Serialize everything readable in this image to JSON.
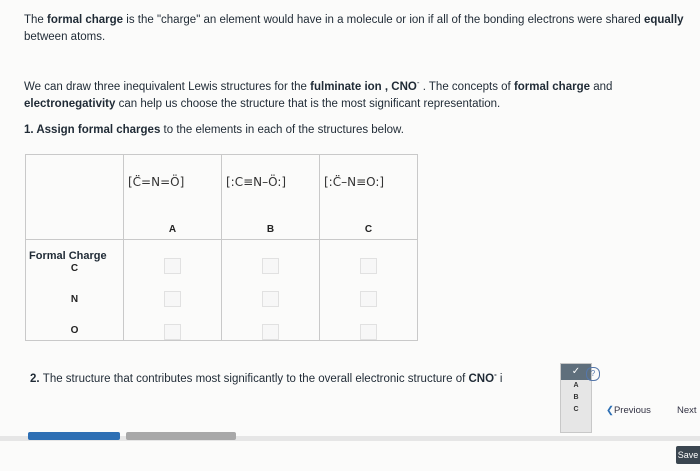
{
  "intro": {
    "p1_a": "The ",
    "p1_b": "formal charge",
    "p1_c": " is the \"charge\" an element would have in a molecule or ion if all of the bonding electrons were shared ",
    "p1_d": "equally",
    "p1_e": " between atoms."
  },
  "para2": {
    "a": "We can draw three inequivalent Lewis structures for the ",
    "b": "fulminate ion",
    "c": " , CNO",
    "c_sup": "-",
    "d": " . The concepts of ",
    "e": "formal charge",
    "f": " and ",
    "g": "electronegativity",
    "h": " can help us choose the structure that is the most significant representation."
  },
  "question1": {
    "num": "1. ",
    "bold": "Assign formal charges",
    "rest": " to the elements in each of the structures below."
  },
  "table": {
    "structures": [
      {
        "label": "A",
        "text": "[C̈=N=Ö]"
      },
      {
        "label": "B",
        "text": "[:C≡N–Ö:]"
      },
      {
        "label": "C",
        "text": "[:C̈–N≡O:]"
      }
    ],
    "row_header": "Formal Charge",
    "rows": [
      "C",
      "N",
      "O"
    ]
  },
  "question2": {
    "num": "2. ",
    "text": "The structure that contributes most significantly to the overall electronic structure of ",
    "bold": "CNO",
    "sup": "-",
    "tail": " i"
  },
  "dropdown": {
    "selected": "✓",
    "options": [
      "A",
      "B",
      "C"
    ]
  },
  "help_pill": "?",
  "nav": {
    "previous": "Previous",
    "next": "Next"
  },
  "save": "Save"
}
